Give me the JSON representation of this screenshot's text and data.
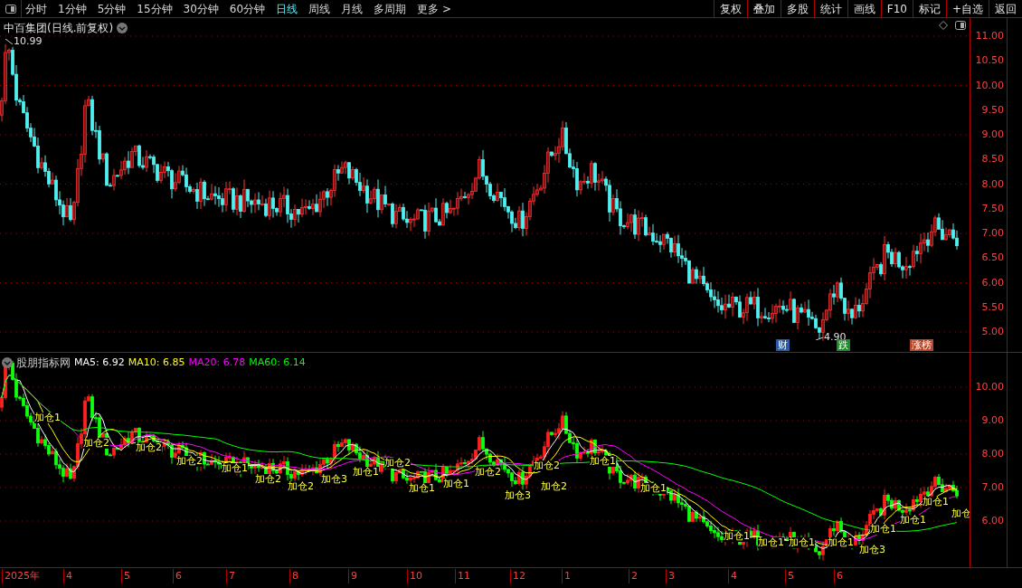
{
  "toolbar": {
    "periods": [
      {
        "label": "分时",
        "selected": false
      },
      {
        "label": "1分钟",
        "selected": false
      },
      {
        "label": "5分钟",
        "selected": false
      },
      {
        "label": "15分钟",
        "selected": false
      },
      {
        "label": "30分钟",
        "selected": false
      },
      {
        "label": "60分钟",
        "selected": false
      },
      {
        "label": "日线",
        "selected": true
      },
      {
        "label": "周线",
        "selected": false
      },
      {
        "label": "月线",
        "selected": false
      },
      {
        "label": "多周期",
        "selected": false
      },
      {
        "label": "更多 >",
        "selected": false
      }
    ],
    "buttons": [
      "复权",
      "叠加",
      "多股",
      "统计",
      "画线",
      "F10",
      "标记",
      "+自选",
      "返回"
    ]
  },
  "main_chart": {
    "title": "中百集团(日线.前复权)",
    "high_label": "10.99",
    "low_label": "4.90",
    "markers": [
      {
        "text": "财",
        "color": "#2a5caa"
      },
      {
        "text": "跌",
        "color": "#1f8a2a"
      },
      {
        "text": "涨榜",
        "color": "#b5482a"
      }
    ],
    "y_ticks": [
      "11.00",
      "10.50",
      "10.00",
      "9.50",
      "9.00",
      "8.50",
      "8.00",
      "7.50",
      "7.00",
      "6.50",
      "6.00",
      "5.50",
      "5.00"
    ]
  },
  "indicator_panel": {
    "name": "股朋指标网",
    "averages": [
      {
        "label": "MA5: 6.92",
        "color": "#ffffff"
      },
      {
        "label": "MA10: 6.85",
        "color": "#ffff00"
      },
      {
        "label": "MA20: 6.78",
        "color": "#ff00ff"
      },
      {
        "label": "MA60: 6.14",
        "color": "#00ff00"
      }
    ],
    "signals": [
      "加仓1",
      "加仓2",
      "加仓2",
      "加仓2",
      "加仓1",
      "加仓2",
      "加仓2",
      "加仓3",
      "加仓1",
      "加仓2",
      "加仓1",
      "加仓1",
      "加仓2",
      "加仓3",
      "加仓2",
      "加仓2",
      "加仓1",
      "加仓1",
      "加仓1",
      "加仓1",
      "加仓1",
      "加仓1",
      "加仓3",
      "加仓1",
      "加仓1",
      "加仓1",
      "加仓"
    ],
    "y_ticks": [
      "10.00",
      "9.00",
      "8.00",
      "7.00",
      "6.00"
    ]
  },
  "x_axis": [
    "2025年",
    "4",
    "5",
    "6",
    "7",
    "8",
    "9",
    "10",
    "11",
    "12",
    "1",
    "2",
    "3",
    "4",
    "5",
    "6"
  ]
}
